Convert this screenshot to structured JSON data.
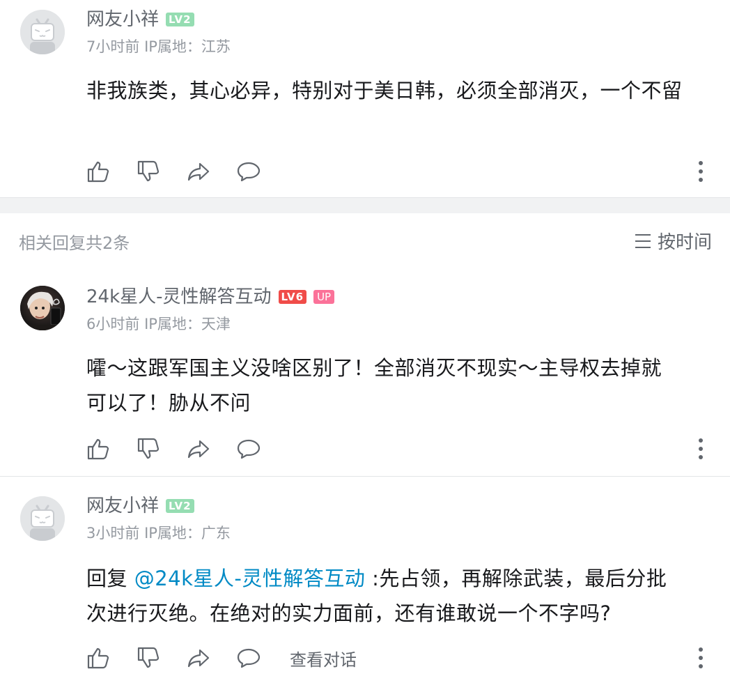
{
  "main_comment": {
    "username": "网友小祥",
    "level": "LV2",
    "time": "7小时前",
    "ip_location": "IP属地：江苏",
    "content": "非我族类，其心必异，特别对于美日韩，必须全部消灭，一个不留"
  },
  "replies_header": {
    "count_label": "相关回复共2条",
    "sort_label": "按时间"
  },
  "replies": [
    {
      "username": "24k星人-灵性解答互动",
      "level": "LV6",
      "badge": "UP",
      "time": "6小时前",
      "ip_location": "IP属地：天津",
      "content_line1": "嚯～这跟军国主义没啥区别了！全部消灭不现实～主导权去掉就",
      "content_line2": "可以了！胁从不问"
    },
    {
      "username": "网友小祥",
      "level": "LV2",
      "time": "3小时前",
      "ip_location": "IP属地：广东",
      "reply_prefix": "回复 ",
      "mention": "@24k星人-灵性解答互动",
      "content_line1": " :先占领，再解除武装，最后分批",
      "content_line2": "次进行灭绝。在绝对的实力面前，还有谁敢说一个不字吗?",
      "view_conversation": "查看对话"
    }
  ],
  "icons": [
    "like-icon",
    "dislike-icon",
    "share-icon",
    "reply-icon",
    "more-icon",
    "sort-icon"
  ],
  "colors": {
    "level_green": "#95ddb2",
    "level_red": "#f04c49",
    "up_badge": "#fb7299",
    "mention": "#008ac5",
    "meta_gray": "#9499a0"
  }
}
